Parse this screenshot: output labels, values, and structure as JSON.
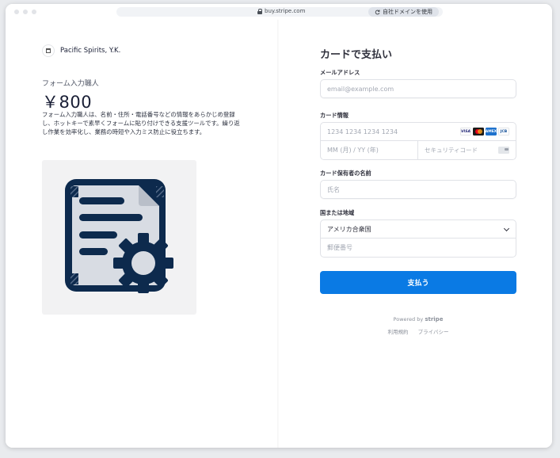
{
  "browser": {
    "url": "buy.stripe.com",
    "custom_domain_label": "自社ドメインを使用"
  },
  "merchant": {
    "name": "Pacific Spirits, Y.K."
  },
  "product": {
    "name": "フォーム入力職人",
    "price": "￥800",
    "description": "フォーム入力職人は、名前・住所・電話番号などの情報をあらかじめ登録し、ホットキーで素早くフォームに貼り付けできる支援ツールです。繰り返し作業を効率化し、業務の時短や入力ミス防止に役立ちます。",
    "image_icon": "document-gear-icon"
  },
  "checkout": {
    "heading": "カードで支払い",
    "email": {
      "label": "メールアドレス",
      "placeholder": "email@example.com"
    },
    "card": {
      "label": "カード情報",
      "number_placeholder": "1234 1234 1234 1234",
      "expiry_placeholder": "MM (月) / YY (年)",
      "cvc_placeholder": "セキュリティコード",
      "brands": [
        "VISA",
        "Mastercard",
        "AMEX",
        "JCB"
      ]
    },
    "cardholder": {
      "label": "カード保有者の名前",
      "placeholder": "氏名"
    },
    "country": {
      "label": "国または地域",
      "value": "アメリカ合衆国",
      "postal_placeholder": "郵便番号"
    },
    "pay_button": "支払う"
  },
  "footer": {
    "powered_by": "Powered by",
    "brand": "stripe",
    "terms": "利用規約",
    "privacy": "プライバシー"
  },
  "colors": {
    "accent": "#0a7ae4",
    "icon_navy": "#0d2a4d",
    "icon_paper": "#d8dce3"
  }
}
